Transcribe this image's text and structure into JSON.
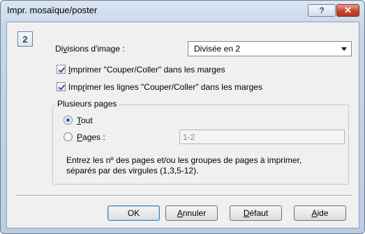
{
  "window": {
    "title": "Impr. mosaïque/poster",
    "help_glyph": "?",
    "close_glyph": "✕"
  },
  "preview_badge": "2",
  "divisions": {
    "label_pre": "Di",
    "label_u": "v",
    "label_post": "isions d'image :",
    "selected": "Divisée en 2"
  },
  "options": {
    "cut_paste_margins": {
      "u": "I",
      "rest": "mprimer \"Couper/Coller\" dans les marges",
      "checked": true
    },
    "cut_paste_lines": {
      "pre": "Imp",
      "u": "r",
      "rest": "imer les lignes \"Couper/Coller\" dans les marges",
      "checked": true
    }
  },
  "multiple_pages": {
    "title": "Plusieurs pages",
    "all": {
      "u": "T",
      "rest": "out",
      "selected": true
    },
    "pages": {
      "u": "P",
      "rest": "ages :",
      "selected": false,
      "value": "1-2"
    },
    "hint_line1": "Entrez les nº des pages et/ou les groupes de pages à imprimer,",
    "hint_line2": "séparés par des virgules (1,3,5-12)."
  },
  "buttons": {
    "ok": "OK",
    "cancel": {
      "u": "A",
      "rest": "nnuler"
    },
    "defaults": {
      "u": "D",
      "rest": "éfaut"
    },
    "help": {
      "u": "A",
      "rest": "ide"
    }
  }
}
